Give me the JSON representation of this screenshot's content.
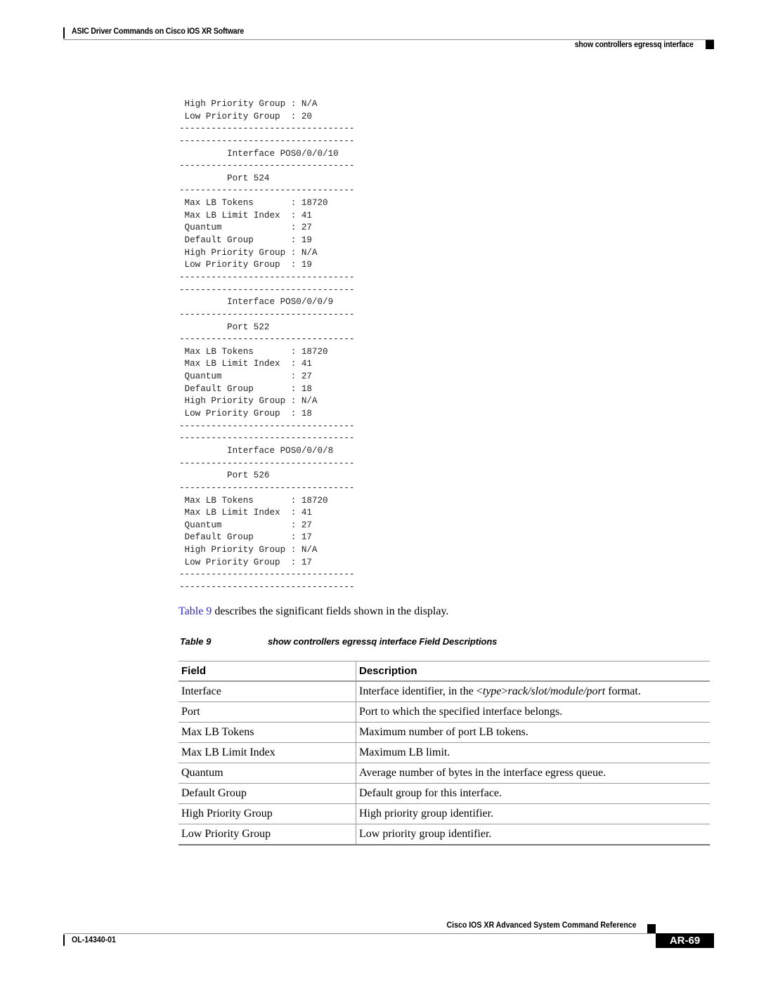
{
  "header": {
    "chapter_title": "ASIC Driver Commands on Cisco IOS XR Software",
    "command_title": "show controllers egressq interface"
  },
  "code_block": {
    "lines": [
      " High Priority Group : N/A",
      " Low Priority Group  : 20",
      "---------------------------------",
      "---------------------------------",
      "         Interface POS0/0/0/10",
      "---------------------------------",
      "         Port 524",
      "---------------------------------",
      " Max LB Tokens       : 18720",
      " Max LB Limit Index  : 41",
      " Quantum             : 27",
      " Default Group       : 19",
      " High Priority Group : N/A",
      " Low Priority Group  : 19",
      "---------------------------------",
      "---------------------------------",
      "         Interface POS0/0/0/9",
      "---------------------------------",
      "         Port 522",
      "---------------------------------",
      " Max LB Tokens       : 18720",
      " Max LB Limit Index  : 41",
      " Quantum             : 27",
      " Default Group       : 18",
      " High Priority Group : N/A",
      " Low Priority Group  : 18",
      "---------------------------------",
      "---------------------------------",
      "         Interface POS0/0/0/8",
      "---------------------------------",
      "         Port 526",
      "---------------------------------",
      " Max LB Tokens       : 18720",
      " Max LB Limit Index  : 41",
      " Quantum             : 27",
      " Default Group       : 17",
      " High Priority Group : N/A",
      " Low Priority Group  : 17",
      "---------------------------------",
      "---------------------------------"
    ]
  },
  "body": {
    "xref_label": "Table 9",
    "sentence_rest": " describes the significant fields shown in the display."
  },
  "table": {
    "caption_number": "Table 9",
    "caption_title": "show controllers egressq interface Field Descriptions",
    "headers": [
      "Field",
      "Description"
    ],
    "rows": [
      {
        "field": "Interface",
        "description_parts": [
          "Interface identifier, in the <",
          "type",
          ">",
          "rack/slot/module/port",
          " format."
        ]
      },
      {
        "field": "Port",
        "description": "Port to which the specified interface belongs."
      },
      {
        "field": "Max LB Tokens",
        "description": "Maximum number of port LB tokens."
      },
      {
        "field": "Max LB Limit Index",
        "description": "Maximum LB limit."
      },
      {
        "field": "Quantum",
        "description": "Average number of bytes in the interface egress queue."
      },
      {
        "field": "Default Group",
        "description": "Default group for this interface."
      },
      {
        "field": "High Priority Group",
        "description": "High priority group identifier."
      },
      {
        "field": "Low Priority Group",
        "description": "Low priority group identifier."
      }
    ]
  },
  "footer": {
    "book_title": "Cisco IOS XR Advanced System Command Reference",
    "doc_number": "OL-14340-01",
    "page_number": "AR-69"
  },
  "colors": {
    "xref_link": "#2a2ac8",
    "page_badge_bg": "#000000",
    "page_badge_text": "#ffffff"
  }
}
